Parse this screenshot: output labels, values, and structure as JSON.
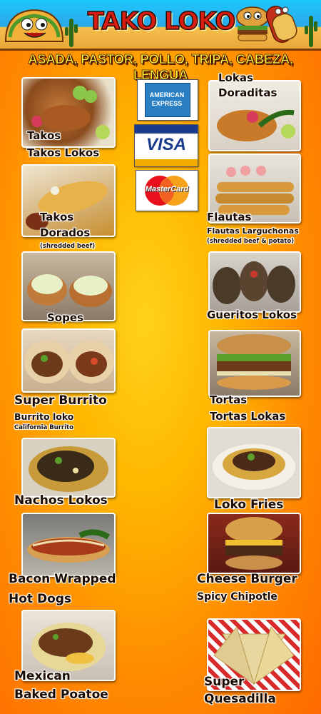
{
  "brand": {
    "title": "TAKO LOKO"
  },
  "meats": "ASADA, PASTOR, POLLO, TRIPA, CABEZA, LENGUA",
  "payments": {
    "amex_line1": "AMERICAN",
    "amex_line2": "EXPRESS",
    "visa": "VISA",
    "mastercard": "MasterCard"
  },
  "left": {
    "takos": {
      "name": "Takos",
      "sub": "Takos Lokos"
    },
    "dorados": {
      "name1": "Takos",
      "name2": "Dorados",
      "note": "(shredded beef)"
    },
    "sopes": {
      "name": "Sopes"
    },
    "burrito": {
      "name": "Super Burrito",
      "sub": "Burrito loko",
      "note": "California Burrito"
    },
    "nachos": {
      "name": "Nachos Lokos"
    },
    "hotdogs": {
      "name1": "Bacon Wrapped",
      "name2": "Hot Dogs"
    },
    "potato": {
      "name1": "Mexican",
      "name2": "Baked Poatoe"
    }
  },
  "right": {
    "doraditas": {
      "name1": "Lokas",
      "name2": "Doraditas"
    },
    "flautas": {
      "name": "Flautas",
      "sub": "Flautas Larguchonas",
      "note": "(shredded beef & potato)"
    },
    "gueritos": {
      "name": "Gueritos Lokos"
    },
    "tortas": {
      "name1": "Tortas",
      "name2": "Tortas Lokas"
    },
    "fries": {
      "name": "Loko Fries"
    },
    "burger": {
      "name": "Cheese Burger",
      "sub": "Spicy Chipotle"
    },
    "quesadilla": {
      "name1": "Super",
      "name2": "Quesadilla"
    }
  },
  "colors": {
    "accent_red": "#d81d12",
    "banner_blue": "#1ec7ff",
    "bg_orange": "#ff8a00"
  }
}
